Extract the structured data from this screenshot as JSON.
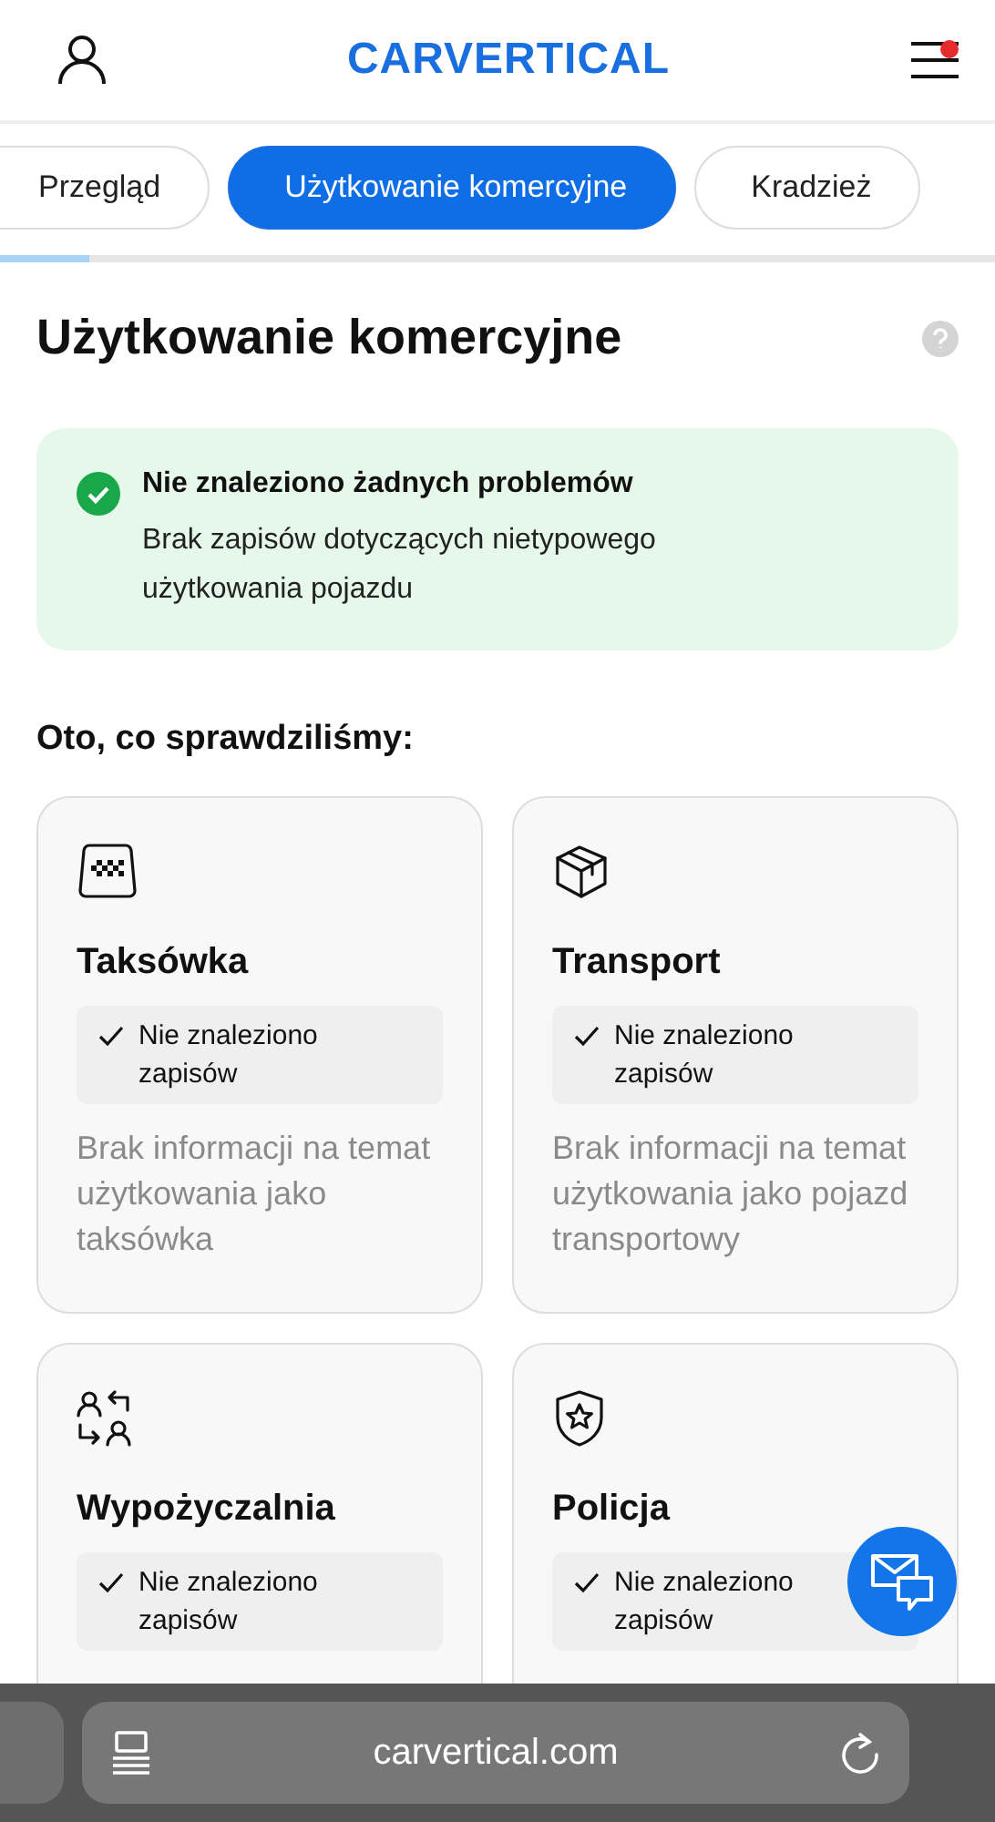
{
  "header": {
    "logo": "CARVERTICAL",
    "menu_notification": true
  },
  "tabs": [
    {
      "label": "Przegląd",
      "selected": false
    },
    {
      "label": "Użytkowanie komercyjne",
      "selected": true
    },
    {
      "label": "Kradzież",
      "selected": false
    }
  ],
  "progress": {
    "level": 0.09
  },
  "section": {
    "title": "Użytkowanie komercyjne"
  },
  "alert": {
    "kind": "success",
    "title": "Nie znaleziono żadnych problemów",
    "text": "Brak zapisów dotyczących nietypowego użytkowania pojazdu"
  },
  "checked_heading": "Oto, co sprawdziliśmy:",
  "cards": [
    {
      "title": "Taksówka",
      "status": "Nie znaleziono zapisów",
      "description": "Brak informacji na temat użytkowania jako taksówka"
    },
    {
      "title": "Transport",
      "status": "Nie znaleziono zapisów",
      "description": "Brak informacji na temat użytkowania jako pojazd transportowy"
    },
    {
      "title": "Wypożyczalnia",
      "status": "Nie znaleziono zapisów"
    },
    {
      "title": "Policja",
      "status": "Nie znaleziono zapisów"
    }
  ],
  "browser": {
    "url": "carvertical.com"
  }
}
